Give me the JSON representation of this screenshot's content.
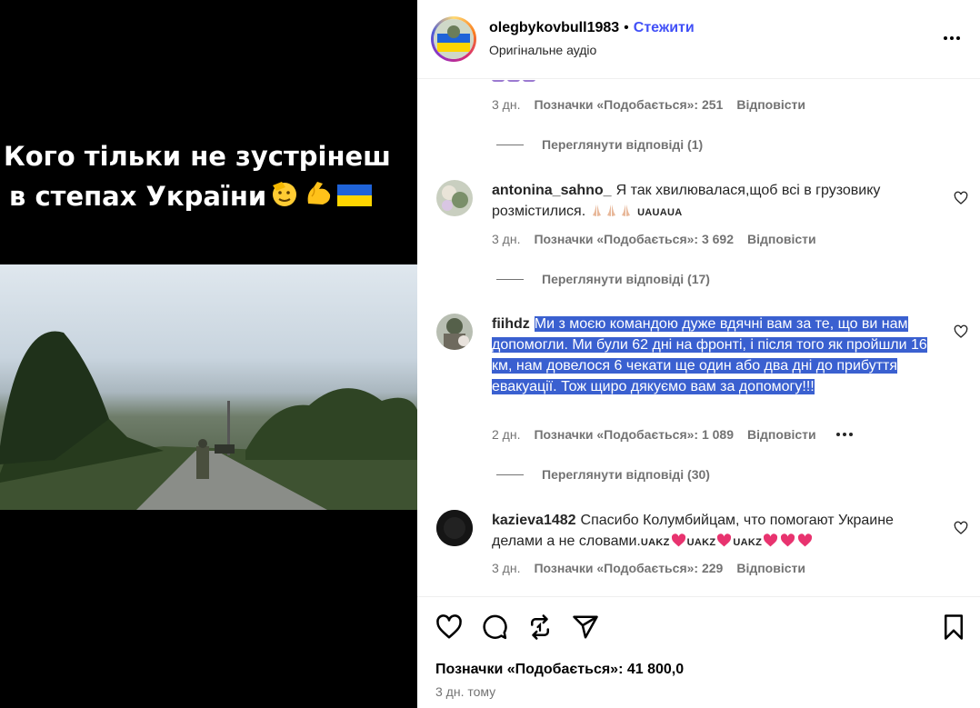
{
  "video": {
    "caption_line1": "Кого тільки не зустрінеш",
    "caption_line2": "в степах України"
  },
  "header": {
    "username": "olegbykovbull1983",
    "separator": "•",
    "follow_label": "Стежити",
    "audio_label": "Оригінальне аудіо"
  },
  "comments": {
    "first_meta": {
      "time": "3 дн.",
      "likes": "Позначки «Подобається»: 251",
      "reply": "Відповісти"
    },
    "first_replies": "Переглянути відповіді (1)",
    "items": [
      {
        "user": "antonina_sahno_",
        "text": "Я так хвилювалася,щоб всі в грузовику розмістилися.",
        "flags": "UAUAUA",
        "time": "3 дн.",
        "likes": "Позначки «Подобається»: 3 692",
        "reply": "Відповісти",
        "replies": "Переглянути відповіді (17)"
      },
      {
        "user": "fiihdz",
        "text": "Ми з моєю командою дуже вдячні вам за те, що ви нам допомогли. Ми були 62 дні на фронті, і після того як пройшли 16 км, нам довелося 6 чекати ще один або два дні до прибуття евакуації. Тож щиро дякуємо вам за допомогу!!!",
        "time": "2 дн.",
        "likes": "Позначки «Подобається»: 1 089",
        "reply": "Відповісти",
        "replies": "Переглянути відповіді (30)"
      },
      {
        "user": "kazieva1482",
        "text": "Спасибо Колумбийцам, что помогают Украине делами а не словами.",
        "flag1": "UAKZ",
        "flag2": "UAKZ",
        "flag3": "UAKZ",
        "time": "3 дн.",
        "likes": "Позначки «Подобається»: 229",
        "reply": "Відповісти"
      }
    ]
  },
  "footer": {
    "likes": "Позначки «Подобається»: 41 800,0",
    "time": "3 дн. тому"
  },
  "icons": {
    "like": "heart-icon",
    "comment": "comment-bubble-icon",
    "share": "repost-icon",
    "send": "paper-plane-icon",
    "save": "bookmark-icon",
    "more": "more-horizontal-icon"
  },
  "colors": {
    "follow": "#4150f7",
    "selection": "#3a60d0",
    "muted": "#737373",
    "heart_emoji": "#e8336f"
  }
}
